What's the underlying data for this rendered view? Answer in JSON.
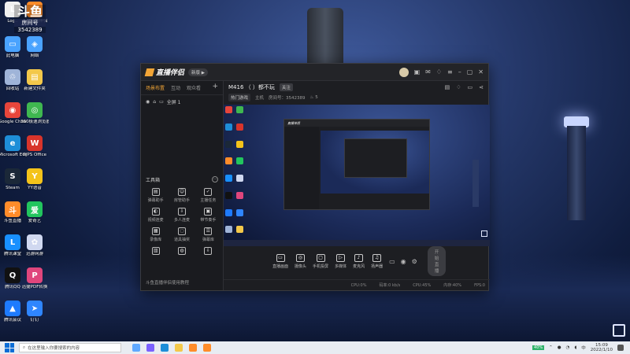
{
  "overlay": {
    "big": "斗鱼",
    "room_label": "房间号",
    "room_id": "3542389"
  },
  "desktop_icons": [
    {
      "label": "Log..",
      "color": "#f0f0f0",
      "glyph": "L"
    },
    {
      "label": "斗鱼直播伴侣",
      "color": "#ff8c2a",
      "glyph": "斗"
    },
    {
      "label": "此电脑",
      "color": "#4aa3ff",
      "glyph": "▭"
    },
    {
      "label": "网络",
      "color": "#4aa3ff",
      "glyph": "◈"
    },
    {
      "label": "回收站",
      "color": "#9fb4d8",
      "glyph": "♲"
    },
    {
      "label": "新建文件夹",
      "color": "#f3c84a",
      "glyph": "▤"
    },
    {
      "label": "Google Chrome",
      "color": "#e7453b",
      "glyph": "◉"
    },
    {
      "label": "360极速浏览器",
      "color": "#3fb750",
      "glyph": "◎"
    },
    {
      "label": "Microsoft Edge",
      "color": "#1e8ed8",
      "glyph": "e"
    },
    {
      "label": "WPS Office",
      "color": "#d8342b",
      "glyph": "W"
    },
    {
      "label": "Steam",
      "color": "#1b2838",
      "glyph": "S"
    },
    {
      "label": "YY语音",
      "color": "#f4c31a",
      "glyph": "Y"
    },
    {
      "label": "斗鱼直播",
      "color": "#ff8c2a",
      "glyph": "斗"
    },
    {
      "label": "爱奇艺",
      "color": "#22c55e",
      "glyph": "爱"
    },
    {
      "label": "腾讯课堂",
      "color": "#1890ff",
      "glyph": "L"
    },
    {
      "label": "迅游网游",
      "color": "#d0d8f0",
      "glyph": "✿"
    },
    {
      "label": "腾讯QQ",
      "color": "#111",
      "glyph": "Q"
    },
    {
      "label": "迅捷PDF转换",
      "color": "#e0467c",
      "glyph": "P"
    },
    {
      "label": "腾讯会议",
      "color": "#1e7bff",
      "glyph": "▲"
    },
    {
      "label": "钉钉",
      "color": "#2f86ff",
      "glyph": "➤"
    }
  ],
  "app": {
    "name": "直播伴侣",
    "badge": "新版 ▶",
    "left_tabs": [
      "场景布置",
      "互动",
      "观众看"
    ],
    "scene_name": "全屏 1",
    "tools_header": "工具箱",
    "tools": [
      {
        "label": "弹幕助手",
        "glyph": "▤"
      },
      {
        "label": "房管助手",
        "glyph": "☺"
      },
      {
        "label": "主播任务",
        "glyph": "✓"
      },
      {
        "label": "视频连麦",
        "glyph": "◐"
      },
      {
        "label": "多人连麦",
        "glyph": "⇩"
      },
      {
        "label": "带节奏手",
        "glyph": "▣"
      },
      {
        "label": "录像库",
        "glyph": "▦"
      },
      {
        "label": "道具抽奖",
        "glyph": "◌"
      },
      {
        "label": "弹幕库",
        "glyph": "☰"
      },
      {
        "label": "",
        "glyph": "▥"
      },
      {
        "label": "",
        "glyph": "◍"
      },
      {
        "label": "",
        "glyph": "⇩"
      }
    ],
    "left_footer": "斗鱼直播伴侣使用教程",
    "room_title": "M416 （ ）都不玩",
    "fav": "关注",
    "category_chip": "热门游戏",
    "category": "主机",
    "room_prefix": "房间号：",
    "room_id": "3542389",
    "heat": "5",
    "controls": [
      {
        "label": "直播画面",
        "glyph": "▭"
      },
      {
        "label": "摄像头",
        "glyph": "◎"
      },
      {
        "label": "手机投屏",
        "glyph": "▢"
      },
      {
        "label": "多媒体",
        "glyph": "▷"
      },
      {
        "label": "麦克风",
        "glyph": "♪"
      },
      {
        "label": "扬声器",
        "glyph": "♫"
      }
    ],
    "go_live": "开始直播",
    "status": [
      "CPU:0%",
      "码率:0 kb/s",
      "CPU:45%",
      "内存:40%",
      "FPS:0"
    ]
  },
  "taskbar": {
    "search_placeholder": "在这里输入你要搜索的内容",
    "time": "15:09",
    "date": "2022/1/10",
    "tray_green": "40%"
  }
}
